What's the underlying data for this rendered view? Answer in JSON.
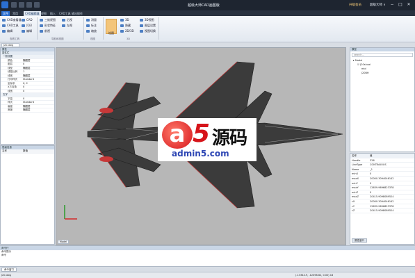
{
  "window": {
    "title": "超级大师CAD画图版",
    "user_badge": "升级会员",
    "user_name": "超级大师 ∨",
    "min_label": "−",
    "max_label": "□",
    "close_label": "✕"
  },
  "menu_tabs": [
    "文件",
    "常用",
    "CAD编辑器",
    "视图",
    "插入",
    "CAD工具",
    "输出操作"
  ],
  "ribbon": {
    "buttons": [
      {
        "label": "CAD查看器",
        "icon": "cad-viewer-icon"
      },
      {
        "label": "CAD工具",
        "icon": "cad-tools-icon"
      },
      {
        "label": "编辑",
        "icon": "edit-icon"
      },
      {
        "label": "CAD",
        "icon": "cad-icon"
      },
      {
        "label": "打印",
        "icon": "print-icon"
      },
      {
        "label": "编辑",
        "icon": "edit2-icon"
      },
      {
        "label": "三维视图",
        "icon": "3d-view-icon"
      },
      {
        "label": "形状特征",
        "icon": "shape-icon"
      },
      {
        "label": "前视",
        "icon": "front-view-icon"
      },
      {
        "label": "后视",
        "icon": "back-view-icon"
      },
      {
        "label": "左视",
        "icon": "left-view-icon"
      },
      {
        "label": "测量",
        "icon": "measure-icon"
      },
      {
        "label": "标注",
        "icon": "dimension-icon"
      },
      {
        "label": "缩放",
        "icon": "zoom-icon"
      },
      {
        "label": "3D",
        "icon": "3d-icon"
      },
      {
        "label": "隐藏",
        "icon": "hide-icon"
      },
      {
        "label": "2D/3D",
        "icon": "2d3d-icon"
      },
      {
        "label": "3D视图",
        "icon": "3d-views-icon"
      },
      {
        "label": "图层设置",
        "icon": "layer-settings-icon"
      },
      {
        "label": "视图切换",
        "icon": "view-switch-icon"
      }
    ],
    "big_button": "绘图",
    "groups": [
      "查看工具",
      "导航和视图",
      "视图",
      "3D"
    ]
  },
  "document_tab": "J20.dwg",
  "properties_panel": {
    "title": "属性",
    "header": "属性栏",
    "rows": [
      {
        "category": "一般设置"
      },
      {
        "key": "颜色",
        "value": "随图层"
      },
      {
        "key": "图层",
        "value": "0"
      },
      {
        "key": "线型",
        "value": "随图层"
      },
      {
        "key": "线型比例",
        "value": "1"
      },
      {
        "key": "线宽",
        "value": "随图层"
      },
      {
        "key": "打印样式",
        "value": "Standard"
      },
      {
        "key": "坐标系",
        "value": "X, 2"
      },
      {
        "key": "X方向角",
        "value": "0"
      },
      {
        "key": "线宽",
        "value": "0"
      },
      {
        "category": "文字"
      },
      {
        "key": "字高",
        "value": "0"
      },
      {
        "key": "样式",
        "value": "Standard"
      },
      {
        "key": "高度",
        "value": "随图层"
      },
      {
        "key": "宽度",
        "value": "随图层"
      }
    ]
  },
  "layer_panel": {
    "title": "层级信息",
    "cols": [
      "名称",
      "数值"
    ]
  },
  "viewport": {
    "tab": "Model"
  },
  "tree_panel": {
    "title": "模型",
    "search": "search...",
    "nodes": [
      "Model",
      "J20shuai",
      "mid",
      "J20BH"
    ]
  },
  "attr_table": {
    "head": [
      "名称",
      "值"
    ],
    "rows": [
      [
        "Handle",
        "326"
      ],
      [
        "LineType",
        "CONTINUOUS"
      ],
      [
        "Name",
        "_1"
      ],
      [
        "minX",
        "0"
      ],
      [
        "maxX",
        "20000.3094046142"
      ],
      [
        "minY",
        "0"
      ],
      [
        "maxY",
        "12639.9696823378"
      ],
      [
        "minZ",
        "0"
      ],
      [
        "maxZ",
        "20415.9098089524"
      ],
      [
        "cX",
        "20000.3094046142"
      ],
      [
        "cY",
        "12639.9696823378"
      ],
      [
        "cZ",
        "20415.9098089524"
      ]
    ],
    "tab": "属性窗口"
  },
  "command": {
    "title": "命令行",
    "lines": [
      "命令提示",
      "命令"
    ],
    "tab": "命令窗口"
  },
  "status": {
    "file": "J20.dwg",
    "coords": "(-13344.9, -12098.62, 0.00) 18"
  },
  "watermark": {
    "a": "a",
    "five": "5",
    "zh": "源码",
    "url": "admin5.com"
  }
}
